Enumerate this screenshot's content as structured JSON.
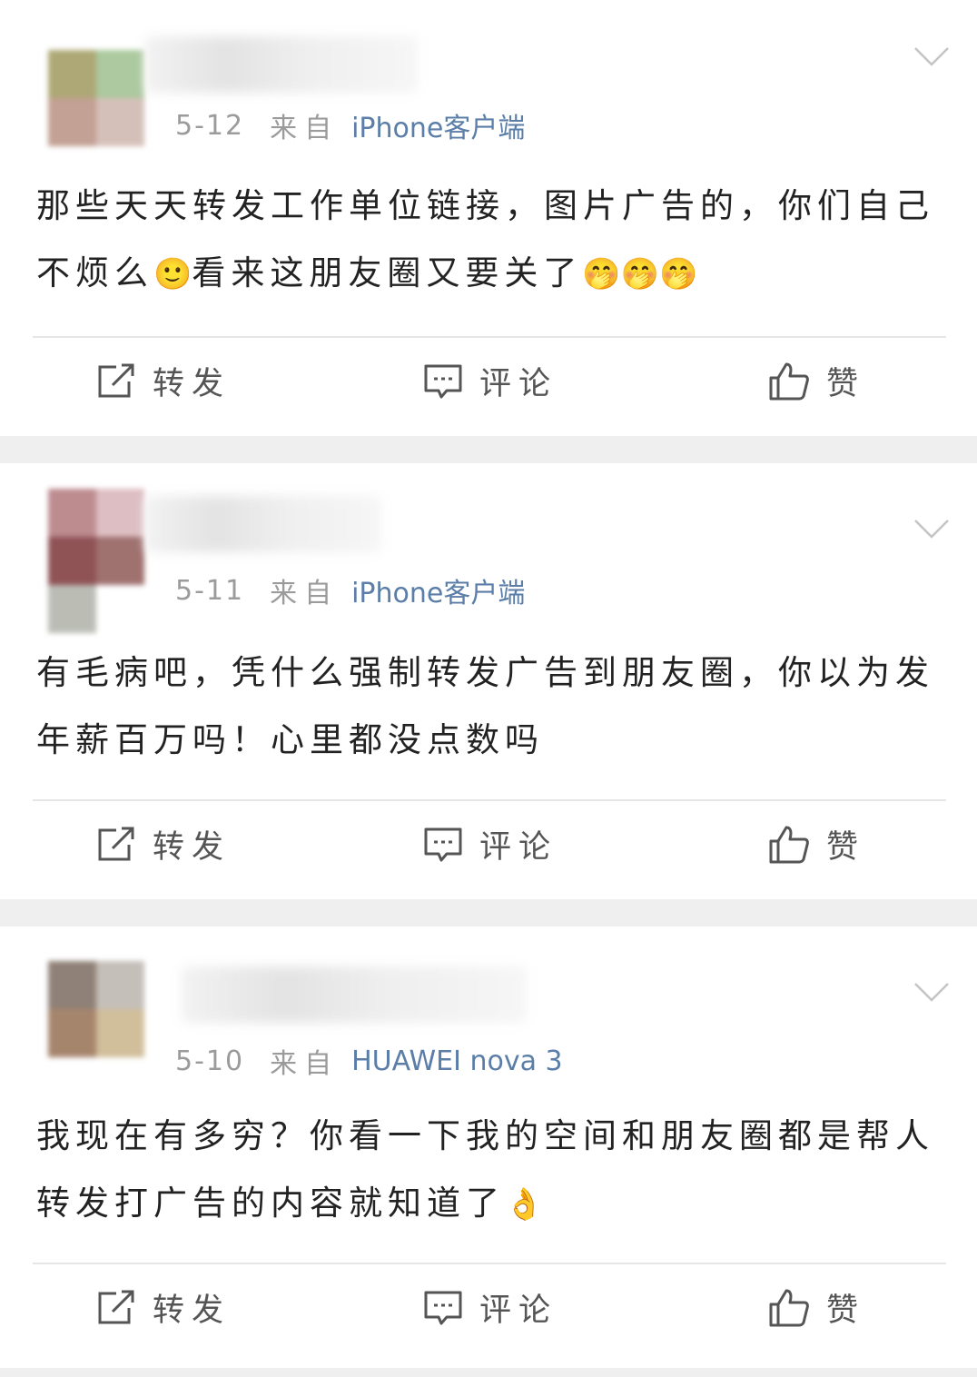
{
  "posts": [
    {
      "date": "5-12",
      "source_prefix": "来自",
      "device": "iPhone客户端",
      "text_1": "那些天天转发工作单位链接，图片广告的，你们自己不烦么",
      "emoji_1": "🙂",
      "text_2": "看来这朋友圈又要关了",
      "emoji_2": "🤭🤭🤭",
      "avatar_colors": [
        "#a9a46f",
        "#a8c79a",
        "#c09c8f",
        "#d3bdb6"
      ],
      "actions": {
        "repost": "转发",
        "comment": "评论",
        "like": "赞"
      }
    },
    {
      "date": "5-11",
      "source_prefix": "来自",
      "device": "iPhone客户端",
      "text_1": "有毛病吧，凭什么强制转发广告到朋友圈，你以为发年薪百万吗！心里都没点数吗",
      "emoji_1": "",
      "text_2": "",
      "emoji_2": "",
      "avatar_colors": [
        "#b9868a",
        "#dcbcc0",
        "#8a4a4e",
        "#9a6a68"
      ],
      "actions": {
        "repost": "转发",
        "comment": "评论",
        "like": "赞"
      }
    },
    {
      "date": "5-10",
      "source_prefix": "来自",
      "device": "HUAWEI nova 3",
      "text_1": "我现在有多穷？你看一下我的空间和朋友圈都是帮人转发打广告的内容就知道了",
      "emoji_1": "👌",
      "text_2": "",
      "emoji_2": "",
      "avatar_colors": [
        "#8a7b70",
        "#c2bcb6",
        "#a27f66",
        "#cfbb96"
      ],
      "actions": {
        "repost": "转发",
        "comment": "评论",
        "like": "赞"
      }
    }
  ],
  "icons": {
    "repost": "repost-icon",
    "comment": "comment-icon",
    "like": "thumbs-up-icon",
    "more": "chevron-down-icon"
  },
  "colors": {
    "device_link": "#5b7ea8",
    "meta": "#9b9b9b",
    "text": "#222222",
    "separator": "#efefef"
  }
}
